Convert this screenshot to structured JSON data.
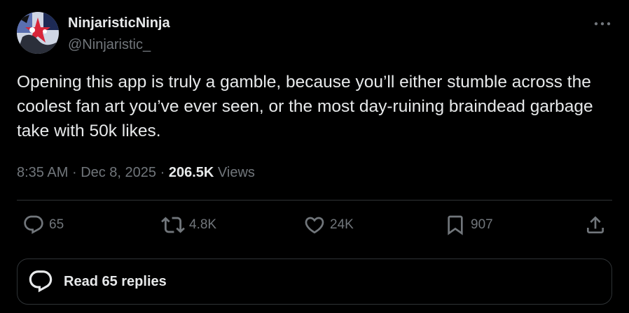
{
  "author": {
    "display_name": "NinjaristicNinja",
    "handle": "@Ninjaristic_"
  },
  "tweet": {
    "text": "Opening this app is truly a gamble, because you’ll either stumble across the coolest fan art you’ve ever seen, or the most day-ruining braindead garbage take with 50k likes."
  },
  "meta": {
    "time": "8:35 AM",
    "separator": "·",
    "date": "Dec 8, 2025",
    "views_count": "206.5K",
    "views_label": "Views"
  },
  "actions": {
    "replies": "65",
    "reposts": "4.8K",
    "likes": "24K",
    "bookmarks": "907"
  },
  "read_replies_label": "Read 65 replies",
  "icons": {
    "more": "more-horizontal-icon",
    "reply": "reply-icon",
    "repost": "repost-icon",
    "like": "heart-icon",
    "bookmark": "bookmark-icon",
    "share": "share-icon",
    "read_replies": "conversation-icon"
  },
  "colors": {
    "background": "#000000",
    "text_primary": "#e7e9ea",
    "text_secondary": "#71767b",
    "border": "#2f3336"
  }
}
